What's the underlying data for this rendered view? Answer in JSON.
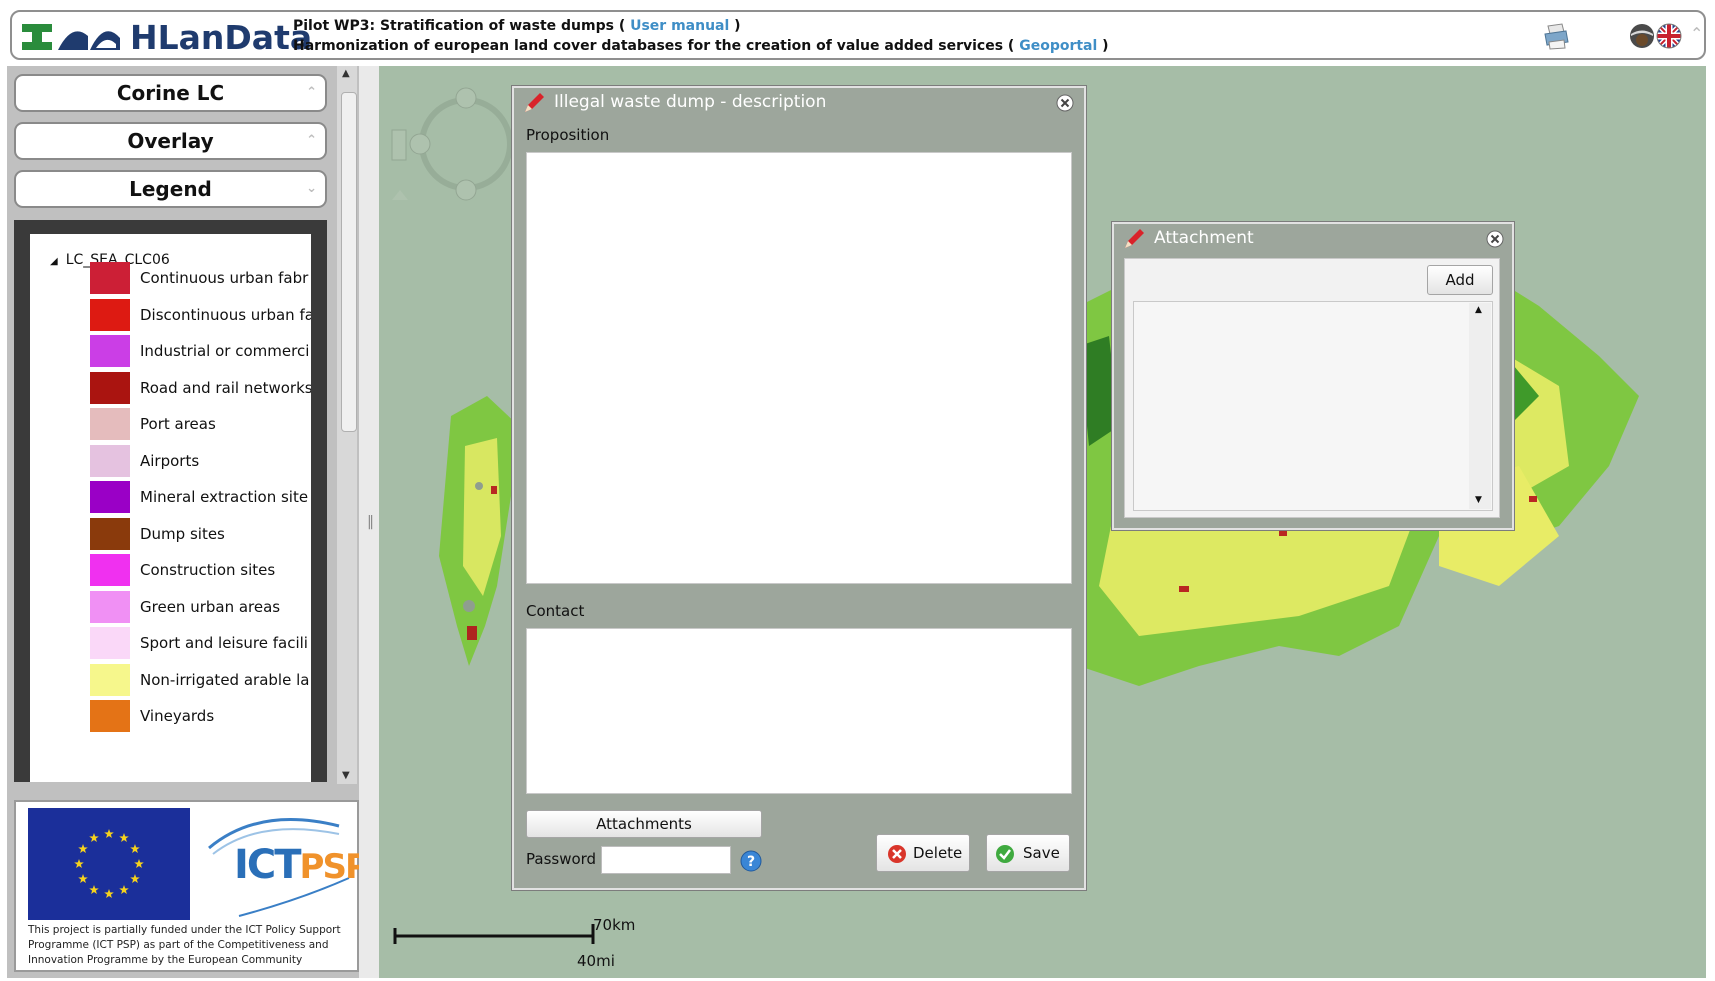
{
  "header": {
    "app_name": "HLanData",
    "line1_prefix": "Pilot WP3: Stratification of waste dumps ( ",
    "line1_link": "User manual",
    "line1_suffix": " )",
    "line2_prefix": "Harmonization of european land cover databases for the creation of value added services ( ",
    "line2_link": "Geoportal",
    "line2_suffix": " )",
    "collapse_glyph": "⌃"
  },
  "sidebar": {
    "panels": [
      "Corine LC",
      "Overlay",
      "Legend"
    ],
    "legend_root": "LC_SEA_CLC06",
    "legend_items": [
      {
        "label": "Continuous urban fabr",
        "color": "#cc1f36"
      },
      {
        "label": "Discontinuous urban fa",
        "color": "#dd1a12"
      },
      {
        "label": "Industrial or commerci",
        "color": "#cb3ee6"
      },
      {
        "label": "Road and rail networks",
        "color": "#aa1410"
      },
      {
        "label": "Port areas",
        "color": "#e5bcbd"
      },
      {
        "label": "Airports",
        "color": "#e5c2e0"
      },
      {
        "label": "Mineral extraction site",
        "color": "#9a00c6"
      },
      {
        "label": "Dump sites",
        "color": "#8a3a0c"
      },
      {
        "label": "Construction sites",
        "color": "#f030f0"
      },
      {
        "label": "Green urban areas",
        "color": "#f090f4"
      },
      {
        "label": "Sport and leisure facili",
        "color": "#fad8f8"
      },
      {
        "label": "Non-irrigated arable la",
        "color": "#f6f78c"
      },
      {
        "label": "Vineyards",
        "color": "#e47316"
      }
    ],
    "funding_note": "This project is partially funded under the ICT Policy Support Programme (ICT PSP) as part of the Competitiveness and Innovation Programme by the European Community",
    "ict_brand": "ICT",
    "ict_brand_psp": "PSP"
  },
  "map": {
    "scale_km": "70km",
    "scale_mi": "40mi"
  },
  "description_dialog": {
    "title": "Illegal waste dump - description",
    "proposition_label": "Proposition",
    "proposition_value": "",
    "contact_label": "Contact",
    "contact_value": "",
    "attachments_button": "Attachments",
    "password_label": "Password",
    "password_value": "",
    "delete_button": "Delete",
    "save_button": "Save"
  },
  "attachment_dialog": {
    "title": "Attachment",
    "add_button": "Add"
  },
  "colors": {
    "accent_link": "#3f8ec6",
    "map_background": "#a6bda7",
    "dialog_background": "#9da69c"
  }
}
